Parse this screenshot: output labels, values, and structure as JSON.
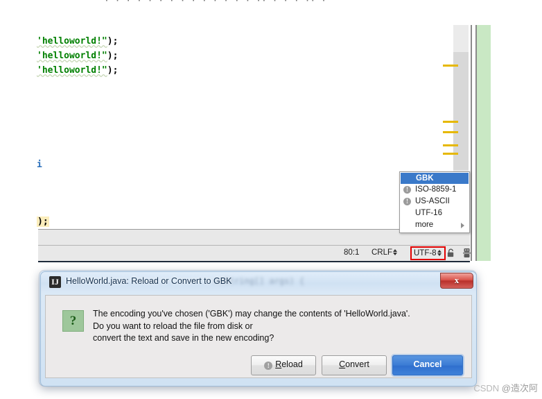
{
  "editor": {
    "top_cut_text": "· · ·  · ·  · ·  ·  · · · · ·  · ·· · ·   · ·· ·",
    "code_lines": [
      {
        "string": "'helloworld!\"",
        "tail": ");"
      },
      {
        "string": "'helloworld!\"",
        "tail": ");"
      },
      {
        "string": "'helloworld!\"",
        "tail": ");"
      }
    ],
    "caret_mark": "i",
    "brace_match_text": ");",
    "warning_marker_label": "warning-marker"
  },
  "encoding_popup": {
    "items": [
      {
        "label": "GBK",
        "selected": true,
        "warn": false,
        "submenu": false
      },
      {
        "label": "ISO-8859-1",
        "selected": false,
        "warn": true,
        "submenu": false
      },
      {
        "label": "US-ASCII",
        "selected": false,
        "warn": true,
        "submenu": false
      },
      {
        "label": "UTF-16",
        "selected": false,
        "warn": false,
        "submenu": false
      },
      {
        "label": "more",
        "selected": false,
        "warn": false,
        "submenu": true
      }
    ],
    "warn_glyph": "!",
    "highlight_color": "#3a79c9"
  },
  "status_bar": {
    "caret_position": "80:1",
    "line_separator": "CRLF",
    "encoding": "UTF-8",
    "encoding_highlight_color": "#e10000",
    "lock_icon": "lock-icon",
    "person_icon": "person-icon"
  },
  "dialog": {
    "app_icon_glyph": "IJ",
    "title": "HelloWorld.java: Reload or Convert to GBK",
    "blurred_background_text": "n(String[] args) {",
    "close_label": "x",
    "question_glyph": "?",
    "message_lines": [
      "The encoding you've chosen ('GBK') may change the contents of 'HelloWorld.java'.",
      "Do you want to reload the file from disk or",
      "convert the text and save in the new encoding?"
    ],
    "buttons": {
      "reload": {
        "prefix": "",
        "mnemonic": "R",
        "rest": "eload",
        "icon": "info-icon"
      },
      "convert": {
        "prefix": "",
        "mnemonic": "C",
        "rest": "onvert"
      },
      "cancel": {
        "label": "Cancel",
        "default": true,
        "color": "#3a7bd4"
      }
    }
  },
  "watermark": {
    "site": "CSDN",
    "author": "@造次阿"
  }
}
